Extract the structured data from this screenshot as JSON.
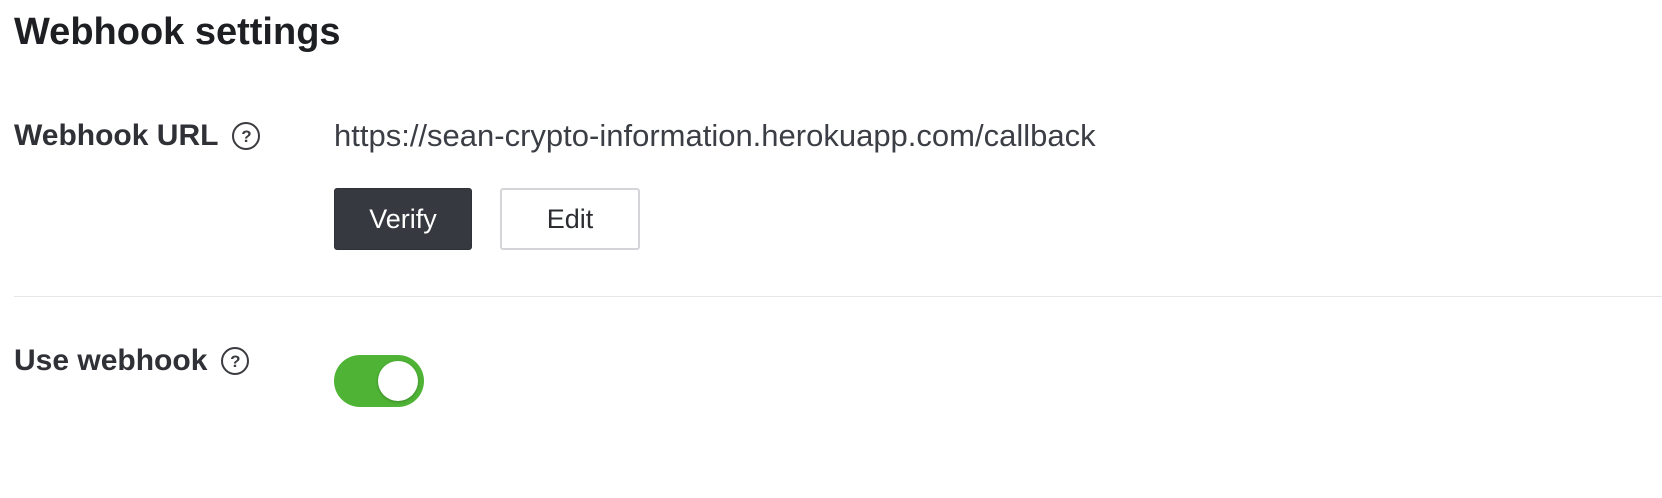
{
  "page": {
    "title": "Webhook settings"
  },
  "webhook_url": {
    "label": "Webhook URL",
    "help_icon": "question-circle-icon",
    "value": "https://sean-crypto-information.herokuapp.com/callback",
    "verify_label": "Verify",
    "edit_label": "Edit"
  },
  "use_webhook": {
    "label": "Use webhook",
    "help_icon": "question-circle-icon",
    "enabled": true
  },
  "colors": {
    "primary_button": "#36393f",
    "toggle_on": "#4fb436",
    "divider": "#e6e7ea"
  }
}
